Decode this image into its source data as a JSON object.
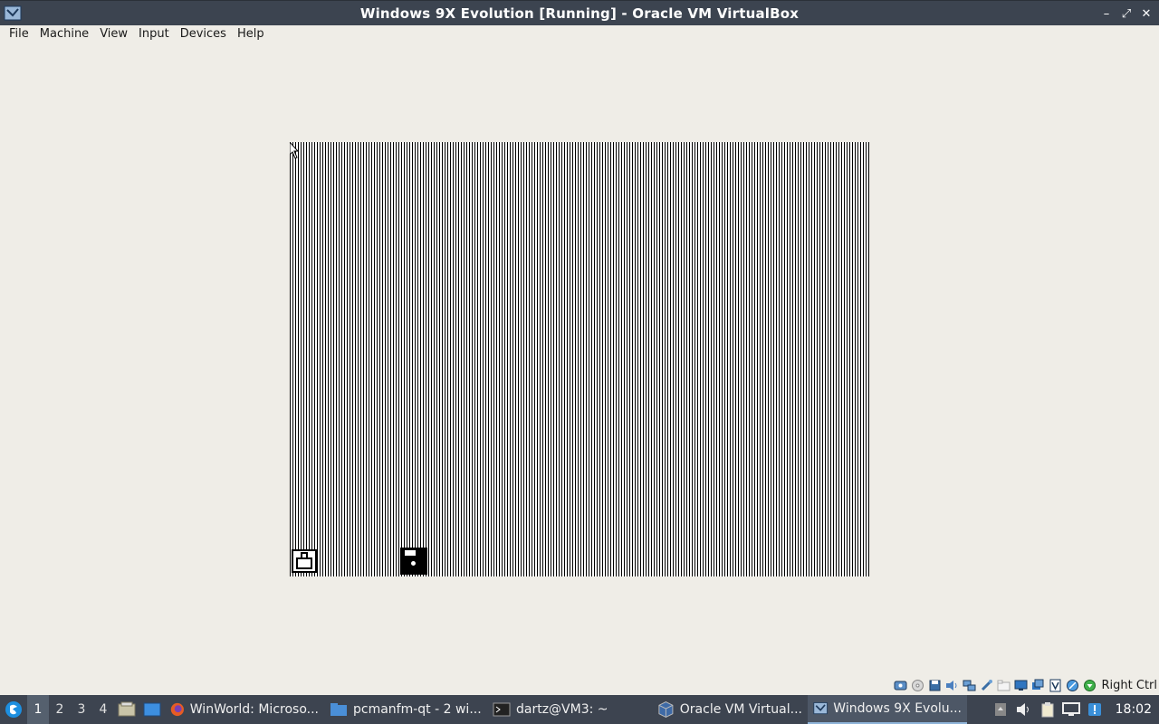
{
  "window": {
    "title": "Windows 9X Evolution [Running] - Oracle VM VirtualBox",
    "controls": [
      "minimize",
      "maximize",
      "close"
    ]
  },
  "menu": {
    "items": [
      "File",
      "Machine",
      "View",
      "Input",
      "Devices",
      "Help"
    ]
  },
  "vm": {
    "screen_pattern": "vertical-stripes"
  },
  "status_bar": {
    "icons": [
      "hard-disk-icon",
      "optical-drive-icon",
      "floppy-icon",
      "audio-icon",
      "network-icon",
      "usb-icon",
      "shared-folder-icon",
      "display-icon",
      "video-capture-icon",
      "virtualization-icon",
      "mouse-integration-icon",
      "arrow-down-icon"
    ],
    "host_key": "Right Ctrl"
  },
  "taskbar": {
    "desktops": [
      "1",
      "2",
      "3",
      "4"
    ],
    "active_desktop": "1",
    "tasks": [
      {
        "label": "WinWorld: Microso...",
        "icon": "firefox-icon"
      },
      {
        "label": "pcmanfm-qt - 2 wi...",
        "icon": "folder-icon"
      },
      {
        "label": "dartz@VM3: ~",
        "icon": "terminal-icon"
      },
      {
        "label": "Oracle VM Virtual...",
        "icon": "virtualbox-icon"
      },
      {
        "label": "Windows 9X Evolu...",
        "icon": "virtualbox-vm-icon"
      }
    ],
    "clock": "18:02"
  },
  "colors": {
    "titlebar_bg": "#3c4450",
    "taskbar_bg": "#3d4450",
    "window_bg": "#efede7",
    "accent": "#8fb4d9"
  }
}
